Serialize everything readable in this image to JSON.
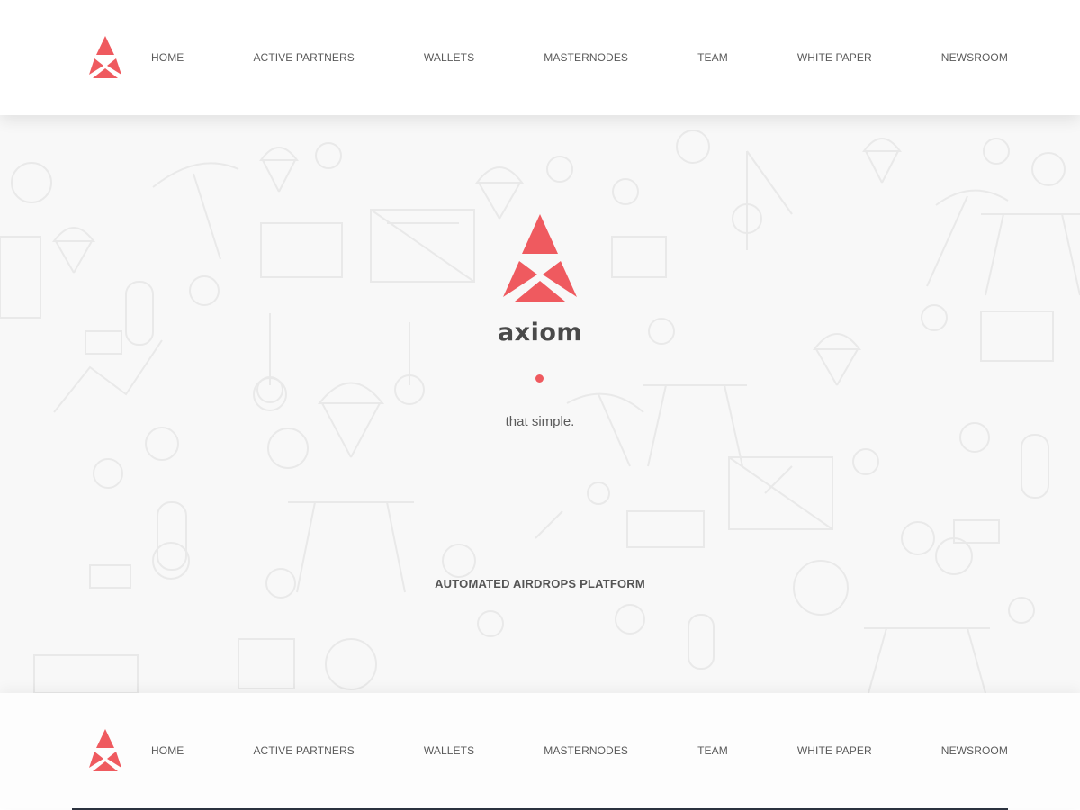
{
  "colors": {
    "accent": "#ef5a5f",
    "text": "#5a5a5a",
    "brand_text": "#4a4a4a",
    "hero_background": "#f8f8f8",
    "bottom_strip": "#2c3340"
  },
  "nav": {
    "logo_icon": "axiom-triangle-logo-icon",
    "items": [
      {
        "label": "HOME"
      },
      {
        "label": "ACTIVE PARTNERS"
      },
      {
        "label": "WALLETS"
      },
      {
        "label": "MASTERNODES"
      },
      {
        "label": "TEAM"
      },
      {
        "label": "WHITE PAPER"
      },
      {
        "label": "NEWSROOM"
      }
    ]
  },
  "hero": {
    "logo_icon": "axiom-triangle-logo-icon",
    "brand": "axiom",
    "tagline": "that simple.",
    "subtitle": "AUTOMATED AIRDROPS PLATFORM",
    "background_pattern": "line-art-icon-pattern"
  },
  "footer_nav": {
    "logo_icon": "axiom-triangle-logo-icon",
    "items": [
      {
        "label": "HOME"
      },
      {
        "label": "ACTIVE PARTNERS"
      },
      {
        "label": "WALLETS"
      },
      {
        "label": "MASTERNODES"
      },
      {
        "label": "TEAM"
      },
      {
        "label": "WHITE PAPER"
      },
      {
        "label": "NEWSROOM"
      }
    ]
  }
}
